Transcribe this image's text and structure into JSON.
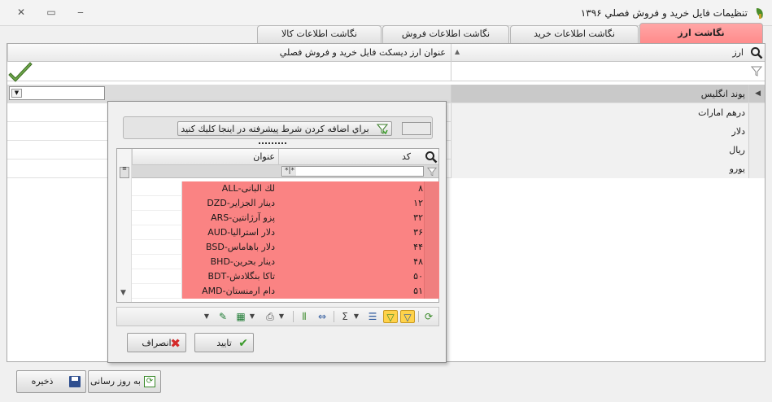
{
  "window": {
    "title": "تنظیمات فایل خرید و فروش فصلي ۱۳۹۶",
    "close_symbol": "✕",
    "maximize_symbol": "▭",
    "minimize_symbol": "‒"
  },
  "tabs": [
    {
      "label": "نگاشت ارز",
      "active": true
    },
    {
      "label": "نگاشت اطلاعات خرید",
      "active": false
    },
    {
      "label": "نگاشت اطلاعات فروش",
      "active": false
    },
    {
      "label": "نگاشت اطلاعات کالا",
      "active": false
    }
  ],
  "grid": {
    "columns": [
      "ارز",
      "عنوان ارز دیسکت فایل خرید و فروش فصلي"
    ],
    "rows": [
      "پوند انگلیس",
      "درهم امارات",
      "دلار",
      "ریال",
      "یورو"
    ]
  },
  "dropdown": {
    "advanced_filter_label": "براي اضافه كردن شرط پيشرفته در اينجا كليك كنيد",
    "columns": [
      "کد",
      "عنوان"
    ],
    "filter_placeholder": "*|*",
    "rows": [
      {
        "code": "۸",
        "title": "لك البانی-ALL"
      },
      {
        "code": "۱۲",
        "title": "دينار الجزاير-DZD"
      },
      {
        "code": "۳۲",
        "title": "پزو آرژانتين-ARS"
      },
      {
        "code": "۳۶",
        "title": "دلار استراليا-AUD"
      },
      {
        "code": "۴۴",
        "title": "دلار باهاماس-BSD"
      },
      {
        "code": "۴۸",
        "title": "دينار بحرين-BHD"
      },
      {
        "code": "۵۰",
        "title": "تاكا بنگلادش-BDT"
      },
      {
        "code": "۵۱",
        "title": "دام ارمنستان-AMD"
      }
    ],
    "confirm_label": "تایید",
    "cancel_label": "انصراف"
  },
  "footer": {
    "update_label": "به روز رسانی",
    "save_label": "ذخیره"
  },
  "colors": {
    "active_tab": "#ff8a8a",
    "highlight_rows": "#fa8383",
    "toolbar_highlight": "#ffd24a"
  }
}
